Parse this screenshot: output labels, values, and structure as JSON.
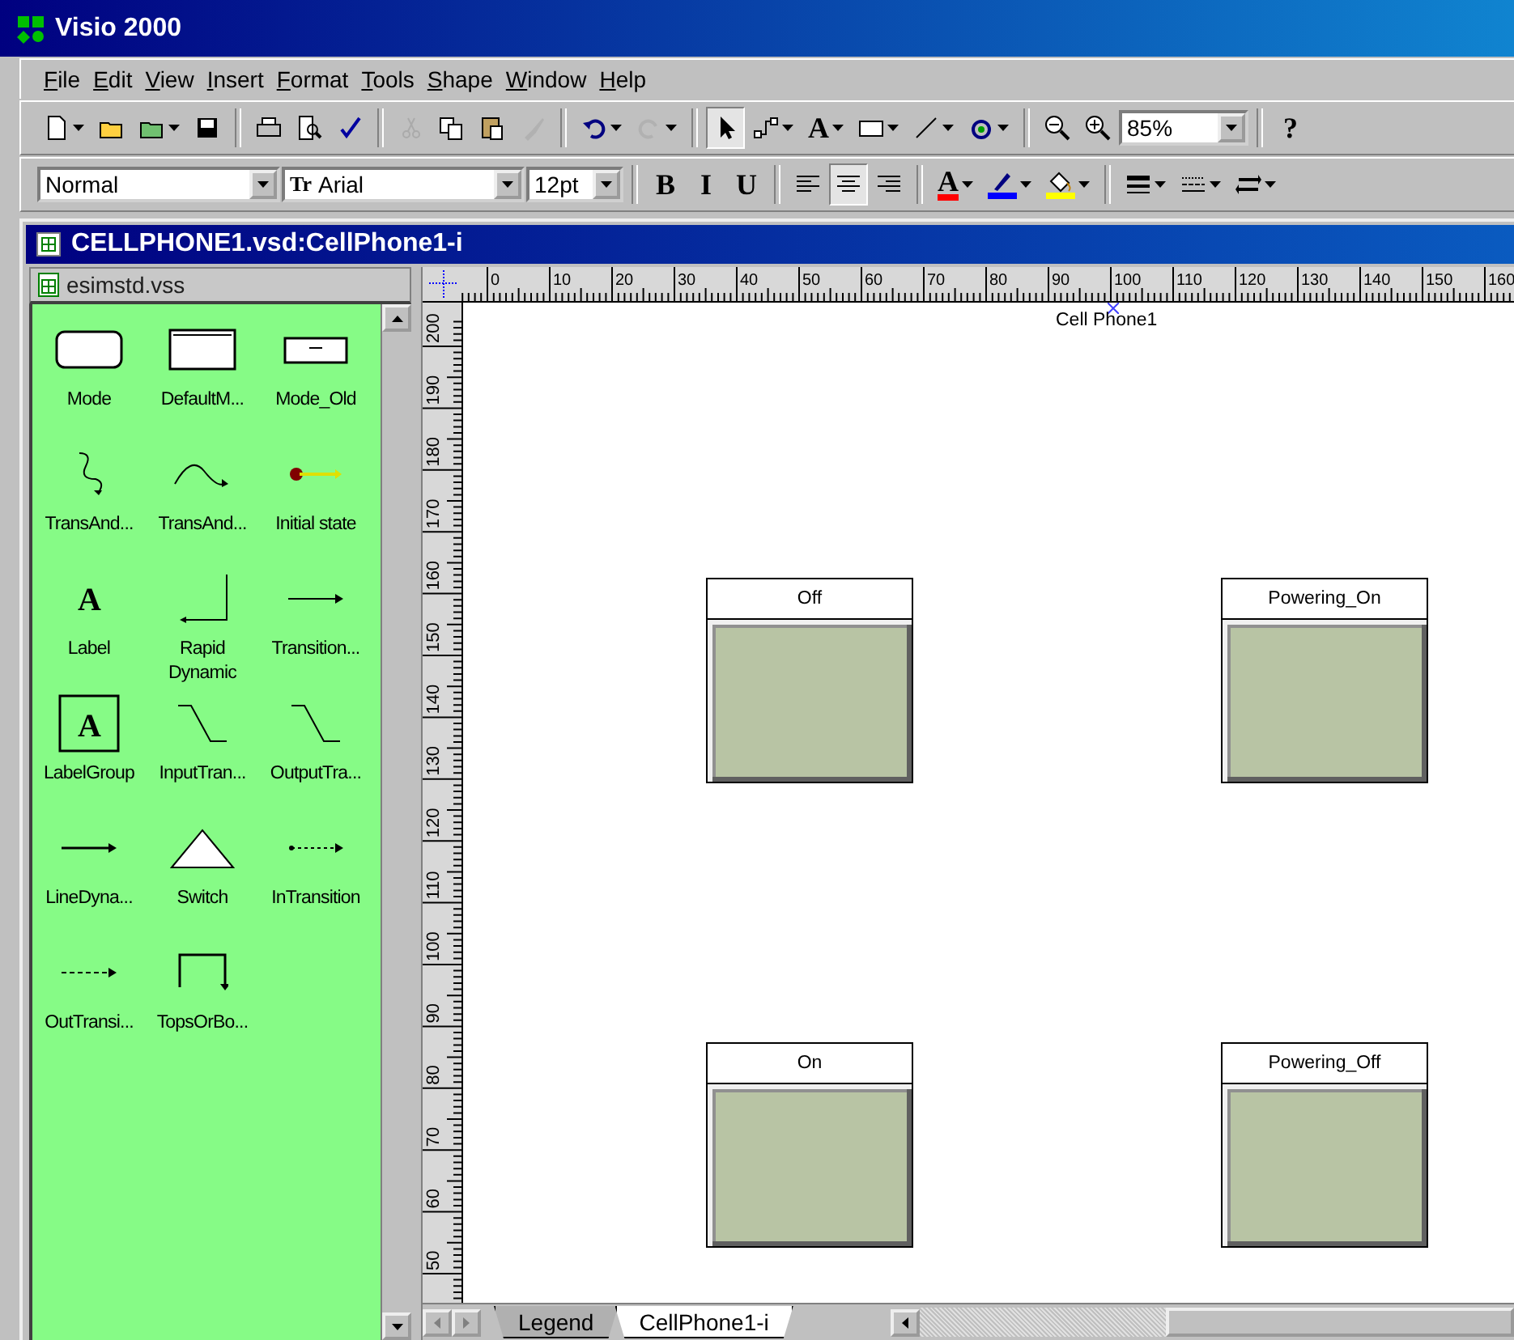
{
  "window": {
    "title": "Visio 2000"
  },
  "menu": [
    {
      "label": "File"
    },
    {
      "label": "Edit"
    },
    {
      "label": "View"
    },
    {
      "label": "Insert"
    },
    {
      "label": "Format"
    },
    {
      "label": "Tools"
    },
    {
      "label": "Shape"
    },
    {
      "label": "Window"
    },
    {
      "label": "Help"
    }
  ],
  "standard_toolbar": [
    {
      "kind": "button",
      "dropdown": true,
      "disabled": false,
      "selected": false
    },
    {
      "kind": "button",
      "dropdown": false,
      "disabled": false,
      "selected": false
    },
    {
      "kind": "button",
      "dropdown": true,
      "disabled": false,
      "selected": false
    },
    {
      "kind": "button",
      "dropdown": false,
      "disabled": false,
      "selected": false
    },
    {
      "kind": "separator"
    },
    {
      "kind": "button",
      "dropdown": false,
      "disabled": false,
      "selected": false
    },
    {
      "kind": "button",
      "dropdown": false,
      "disabled": false,
      "selected": false
    },
    {
      "kind": "button",
      "dropdown": false,
      "disabled": false,
      "selected": false
    },
    {
      "kind": "separator"
    },
    {
      "kind": "button",
      "dropdown": false,
      "disabled": true,
      "selected": false
    },
    {
      "kind": "button",
      "dropdown": false,
      "disabled": false,
      "selected": false
    },
    {
      "kind": "button",
      "dropdown": false,
      "disabled": false,
      "selected": false
    },
    {
      "kind": "button",
      "dropdown": false,
      "disabled": true,
      "selected": false
    },
    {
      "kind": "separator"
    },
    {
      "kind": "button",
      "dropdown": true,
      "disabled": false,
      "selected": false
    },
    {
      "kind": "button",
      "dropdown": true,
      "disabled": true,
      "selected": false
    },
    {
      "kind": "separator"
    },
    {
      "kind": "button",
      "dropdown": false,
      "disabled": false,
      "selected": true
    },
    {
      "kind": "button",
      "dropdown": true,
      "disabled": false,
      "selected": false
    },
    {
      "kind": "text_button",
      "text": "A",
      "dropdown": true,
      "disabled": false,
      "selected": false
    },
    {
      "kind": "button",
      "dropdown": true,
      "disabled": false,
      "selected": false
    },
    {
      "kind": "button",
      "dropdown": true,
      "disabled": false,
      "selected": false
    },
    {
      "kind": "button",
      "dropdown": true,
      "disabled": false,
      "selected": false
    },
    {
      "kind": "separator"
    },
    {
      "kind": "button",
      "dropdown": false,
      "disabled": false,
      "selected": false
    },
    {
      "kind": "button",
      "dropdown": false,
      "disabled": false,
      "selected": false
    },
    {
      "kind": "combo",
      "value": "85%"
    },
    {
      "kind": "separator"
    },
    {
      "kind": "text_button",
      "text": "?",
      "dropdown": false,
      "disabled": false,
      "selected": false
    }
  ],
  "format_toolbar": [
    {
      "kind": "combo",
      "value": "Normal"
    },
    {
      "kind": "combo",
      "value": "Arial",
      "glyph": "Tr"
    },
    {
      "kind": "combo",
      "value": "12pt"
    },
    {
      "kind": "separator"
    },
    {
      "kind": "text_button",
      "text": "B",
      "dropdown": false,
      "disabled": false,
      "selected": false
    },
    {
      "kind": "text_button",
      "text": "I",
      "dropdown": false,
      "disabled": false,
      "selected": false
    },
    {
      "kind": "text_button",
      "text": "U",
      "dropdown": false,
      "disabled": false,
      "selected": false
    },
    {
      "kind": "separator"
    },
    {
      "kind": "button",
      "dropdown": false,
      "disabled": false,
      "selected": false
    },
    {
      "kind": "button",
      "dropdown": false,
      "disabled": false,
      "selected": true
    },
    {
      "kind": "button",
      "dropdown": false,
      "disabled": false,
      "selected": false
    },
    {
      "kind": "separator"
    },
    {
      "kind": "text_button",
      "text": "A",
      "dropdown": true,
      "disabled": false,
      "selected": false,
      "color": "#ff0000"
    },
    {
      "kind": "button",
      "dropdown": true,
      "disabled": false,
      "selected": false,
      "color": "#0000ff"
    },
    {
      "kind": "button",
      "dropdown": true,
      "disabled": false,
      "selected": false,
      "color": "#ffff00"
    },
    {
      "kind": "separator"
    },
    {
      "kind": "button",
      "dropdown": true,
      "disabled": false,
      "selected": false
    },
    {
      "kind": "button",
      "dropdown": true,
      "disabled": false,
      "selected": false
    },
    {
      "kind": "button",
      "dropdown": true,
      "disabled": false,
      "selected": false
    }
  ],
  "document": {
    "title": "CELLPHONE1.vsd:CellPhone1-i"
  },
  "stencil": {
    "title": "esimstd.vss",
    "shapes": [
      {
        "label": "Mode"
      },
      {
        "label": "DefaultM..."
      },
      {
        "label": "Mode_Old"
      },
      {
        "label": "TransAnd..."
      },
      {
        "label": "TransAnd..."
      },
      {
        "label": "Initial state"
      },
      {
        "label": "Label",
        "glyph": "A"
      },
      {
        "label": "Rapid Dynamic"
      },
      {
        "label": "Transition..."
      },
      {
        "label": "LabelGroup",
        "glyph": "A"
      },
      {
        "label": "InputTran..."
      },
      {
        "label": "OutputTra..."
      },
      {
        "label": "LineDyna..."
      },
      {
        "label": "Switch"
      },
      {
        "label": "InTransition"
      },
      {
        "label": "OutTransi..."
      },
      {
        "label": "TopsOrBo..."
      }
    ]
  },
  "top_ruler": [
    "0",
    "10",
    "20",
    "30",
    "40",
    "50",
    "60",
    "70",
    "80",
    "90",
    "100",
    "110",
    "120",
    "130",
    "140",
    "150",
    "160"
  ],
  "left_ruler": [
    "200",
    "190",
    "180",
    "170",
    "160",
    "150",
    "140",
    "130",
    "120",
    "110",
    "100",
    "90",
    "80",
    "70",
    "60",
    "50"
  ],
  "canvas": {
    "page_label": "Cell Phone1",
    "states": [
      {
        "label": "Off"
      },
      {
        "label": "Powering_On"
      },
      {
        "label": "On"
      },
      {
        "label": "Powering_Off"
      }
    ]
  },
  "page_tabs": [
    {
      "label": "Legend",
      "selected": false
    },
    {
      "label": "CellPhone1-i",
      "selected": true
    }
  ]
}
